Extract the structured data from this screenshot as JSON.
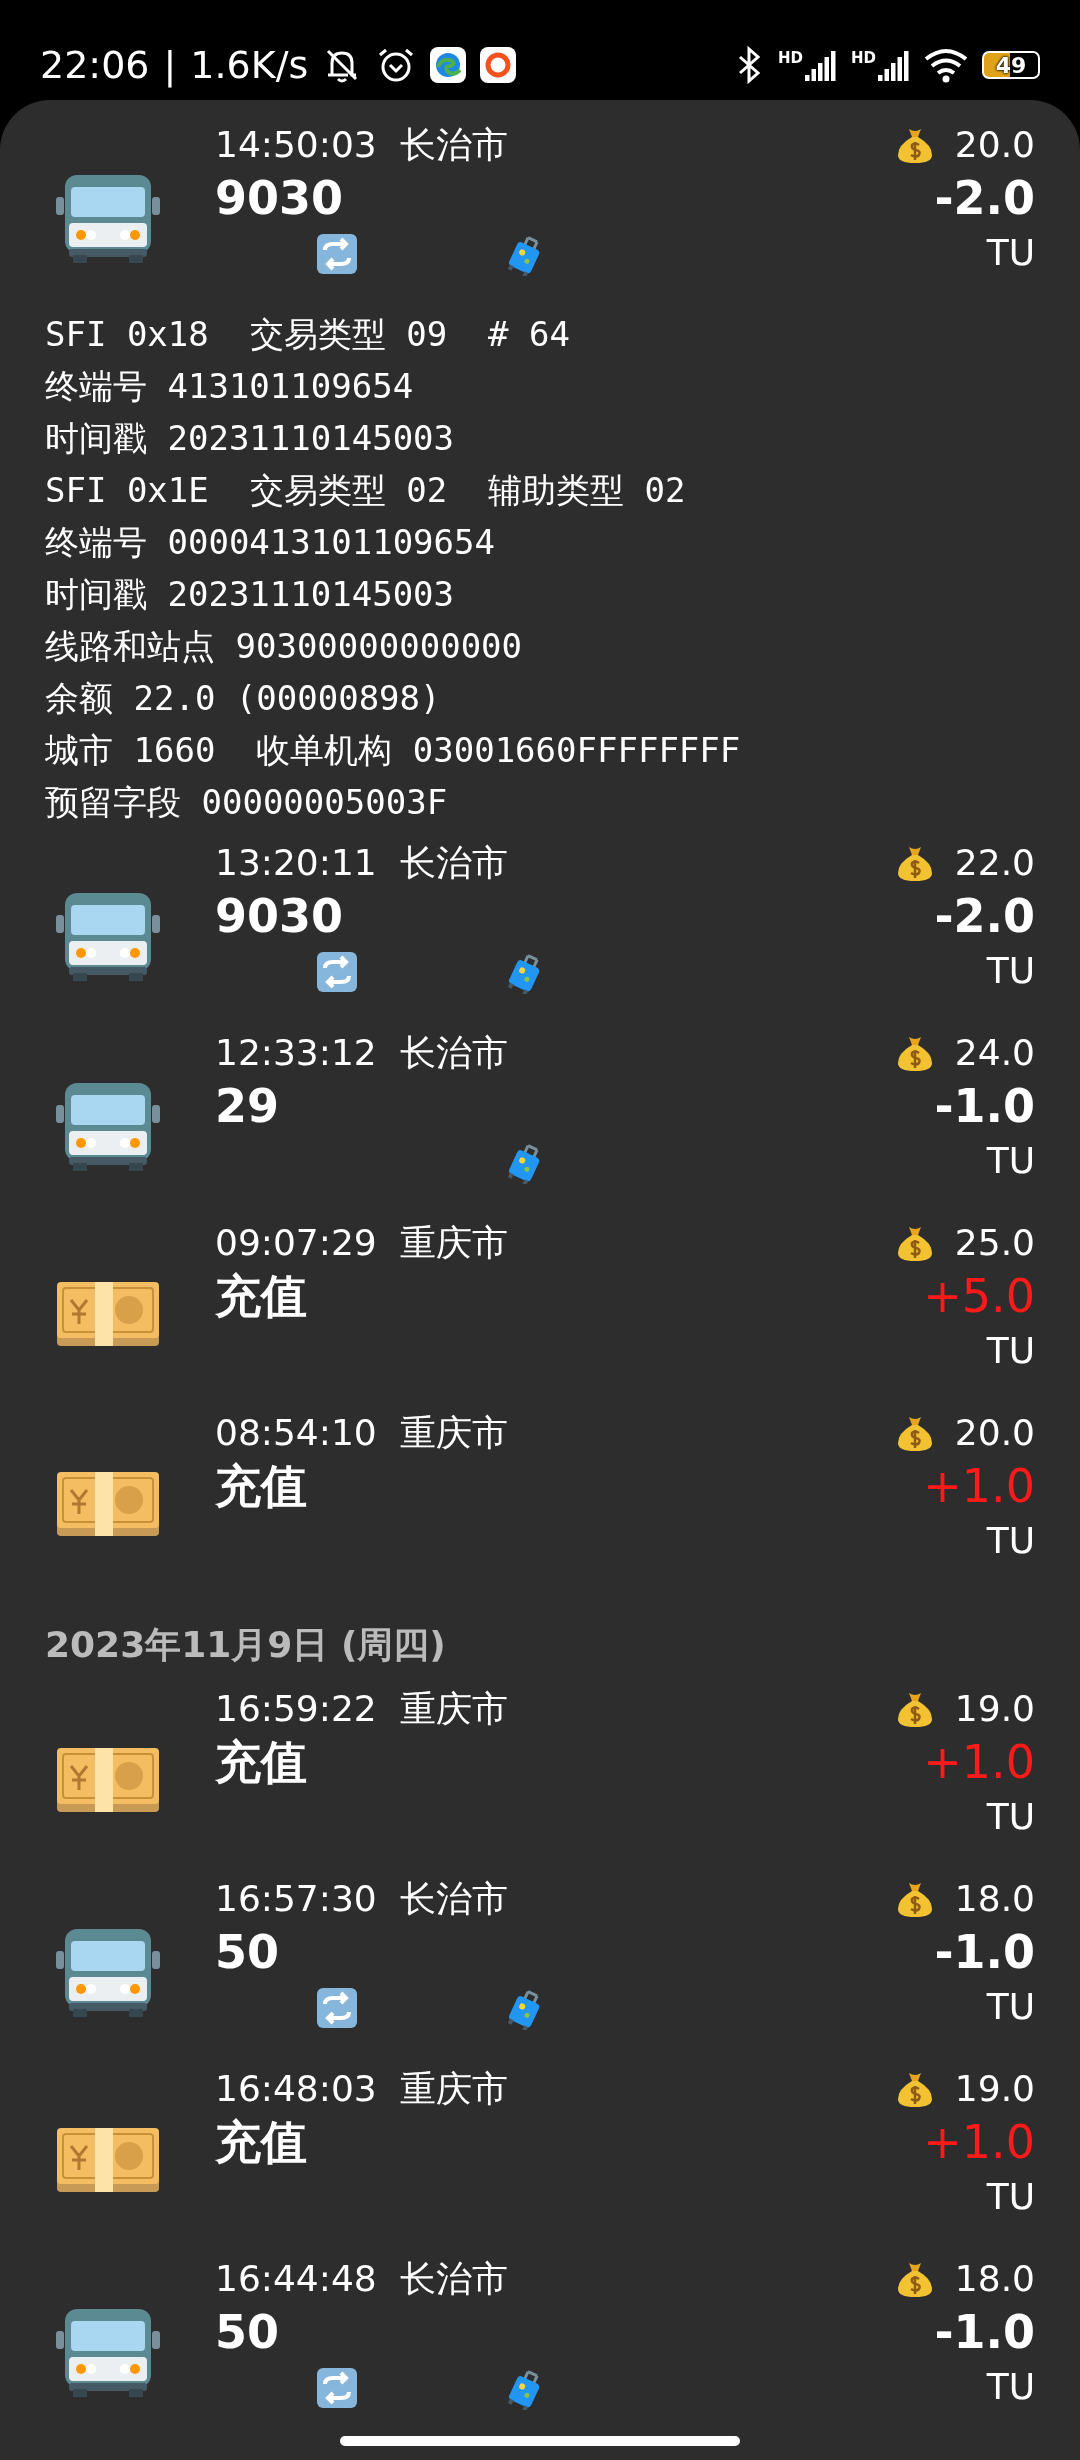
{
  "status_bar": {
    "time": "22:06",
    "separator": "|",
    "speed": "1.6K/s",
    "signal_labels": [
      "HD",
      "HD"
    ],
    "battery": "49"
  },
  "groups": [
    {
      "records": [
        {
          "kind": "bus",
          "time": "14:50:03",
          "city": "长治市",
          "title": "9030",
          "balance": "20.0",
          "amount": "-2.0",
          "unit": "TU",
          "transfer": true,
          "luggage": true,
          "details": [
            "SFI 0x18  交易类型 09  # 64",
            "终端号 413101109654",
            "时间戳 20231110145003",
            "SFI 0x1E  交易类型 02  辅助类型 02",
            "终端号 0000413101109654",
            "时间戳 20231110145003",
            "线路和站点 90300000000000",
            "余额 22.0 (00000898)",
            "城市 1660  收单机构 03001660FFFFFFFF",
            "预留字段 00000005003F"
          ]
        },
        {
          "kind": "bus",
          "time": "13:20:11",
          "city": "长治市",
          "title": "9030",
          "balance": "22.0",
          "amount": "-2.0",
          "unit": "TU",
          "transfer": true,
          "luggage": true
        },
        {
          "kind": "bus",
          "time": "12:33:12",
          "city": "长治市",
          "title": "29",
          "balance": "24.0",
          "amount": "-1.0",
          "unit": "TU",
          "transfer": false,
          "luggage": true
        },
        {
          "kind": "topup",
          "time": "09:07:29",
          "city": "重庆市",
          "title": "充值",
          "balance": "25.0",
          "amount": "+5.0",
          "unit": "TU",
          "transfer": false,
          "luggage": false
        },
        {
          "kind": "topup",
          "time": "08:54:10",
          "city": "重庆市",
          "title": "充值",
          "balance": "20.0",
          "amount": "+1.0",
          "unit": "TU",
          "transfer": false,
          "luggage": false
        }
      ]
    },
    {
      "date": "2023年11月9日 (周四)",
      "records": [
        {
          "kind": "topup",
          "time": "16:59:22",
          "city": "重庆市",
          "title": "充值",
          "balance": "19.0",
          "amount": "+1.0",
          "unit": "TU",
          "transfer": false,
          "luggage": false
        },
        {
          "kind": "bus",
          "time": "16:57:30",
          "city": "长治市",
          "title": "50",
          "balance": "18.0",
          "amount": "-1.0",
          "unit": "TU",
          "transfer": true,
          "luggage": true
        },
        {
          "kind": "topup",
          "time": "16:48:03",
          "city": "重庆市",
          "title": "充值",
          "balance": "19.0",
          "amount": "+1.0",
          "unit": "TU",
          "transfer": false,
          "luggage": false
        },
        {
          "kind": "bus",
          "time": "16:44:48",
          "city": "长治市",
          "title": "50",
          "balance": "18.0",
          "amount": "-1.0",
          "unit": "TU",
          "transfer": true,
          "luggage": true
        }
      ]
    }
  ]
}
